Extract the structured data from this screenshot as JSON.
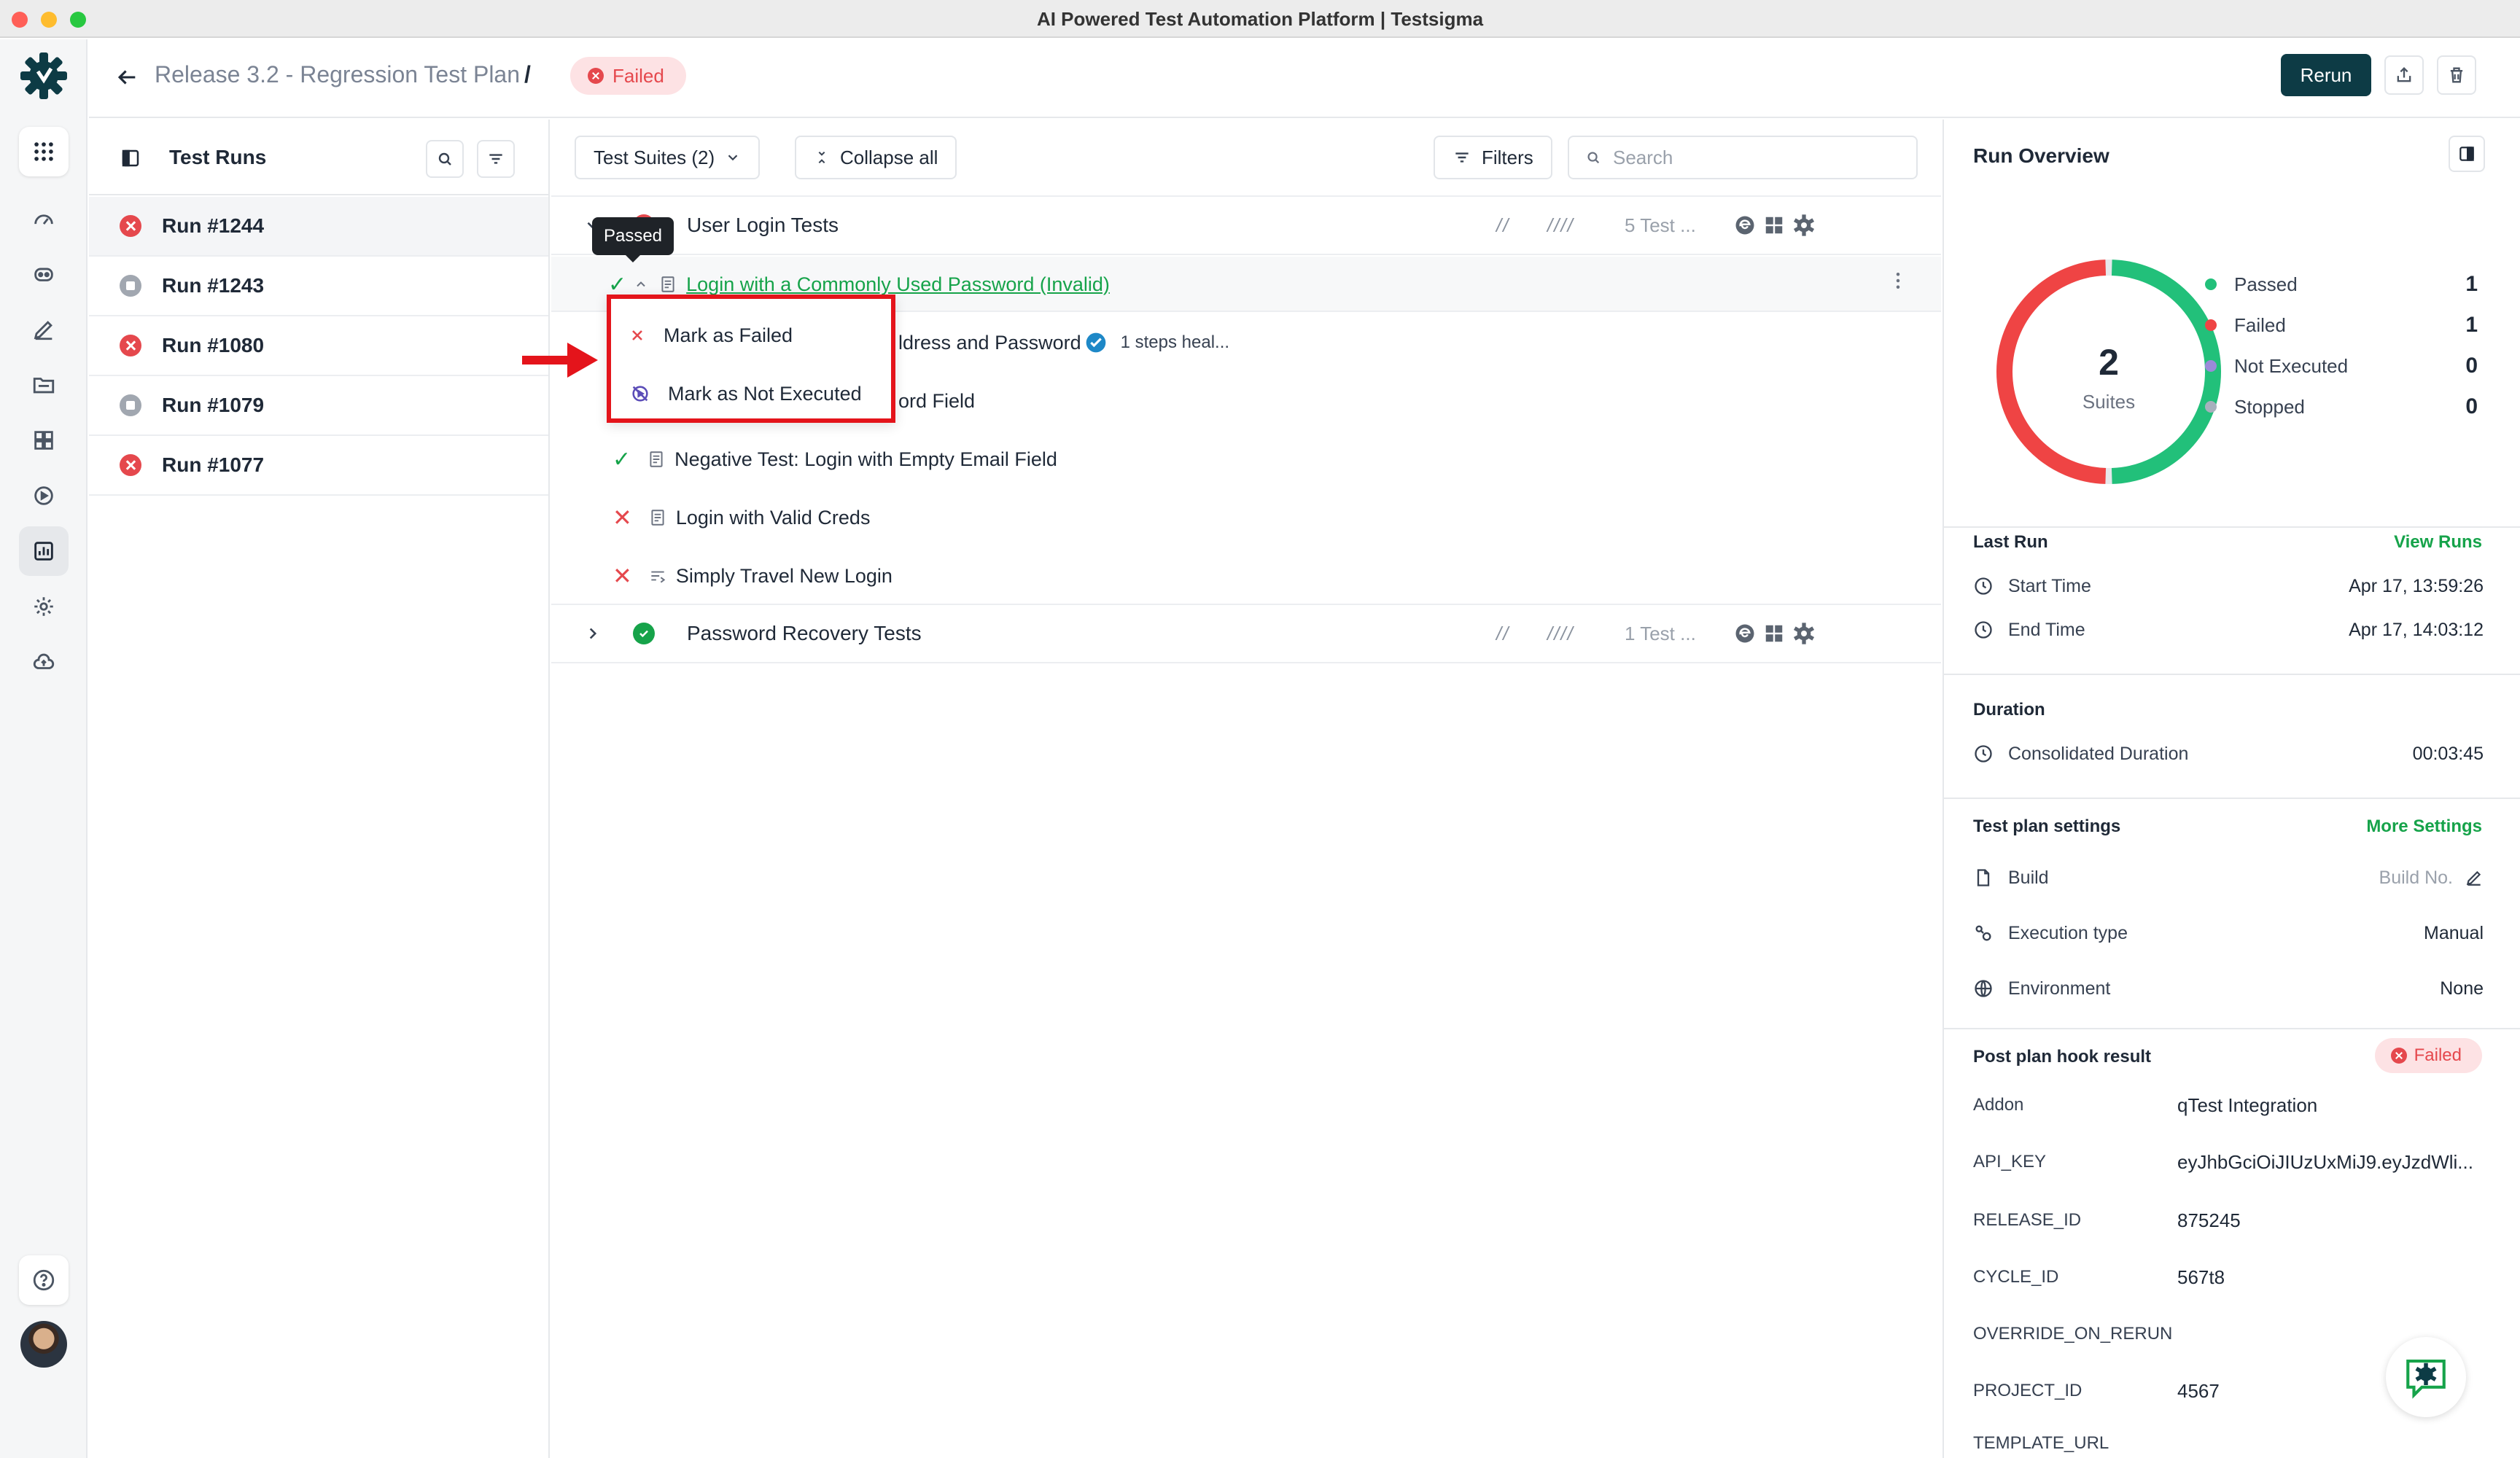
{
  "window": {
    "title": "AI Powered Test Automation Platform | Testsigma"
  },
  "header": {
    "breadcrumb": "Release 3.2 - Regression Test Plan",
    "separator": "/",
    "status": "Failed",
    "rerun_label": "Rerun"
  },
  "runs_panel": {
    "title": "Test Runs",
    "runs": [
      {
        "label": "Run #1244",
        "status": "failed"
      },
      {
        "label": "Run #1243",
        "status": "stopped"
      },
      {
        "label": "Run #1080",
        "status": "failed"
      },
      {
        "label": "Run #1079",
        "status": "stopped"
      },
      {
        "label": "Run #1077",
        "status": "failed"
      }
    ]
  },
  "toolbar": {
    "suites_label": "Test Suites (2)",
    "collapse_label": "Collapse all",
    "filters_label": "Filters",
    "search_placeholder": "Search"
  },
  "suites": [
    {
      "name": "User Login Tests",
      "slash1": "//",
      "slash2": "////",
      "count": "5 Test ...",
      "status": "failed"
    },
    {
      "name": "Password Recovery Tests",
      "slash1": "//",
      "slash2": "////",
      "count": "1 Test ...",
      "status": "passed"
    }
  ],
  "cases": [
    {
      "name": "Login with a Commonly Used Password (Invalid)",
      "status": "passed"
    },
    {
      "name": "ldress and Password",
      "heal": "1 steps heal...",
      "status": "hidden"
    },
    {
      "name": "ord Field",
      "status": "hidden"
    },
    {
      "name": "Negative Test: Login with Empty Email Field",
      "status": "passed"
    },
    {
      "name": "Login with Valid Creds",
      "status": "failed"
    },
    {
      "name": "Simply Travel New Login",
      "status": "failed"
    }
  ],
  "tooltip": "Passed",
  "menu": {
    "mark_failed": "Mark as Failed",
    "mark_not_executed": "Mark as Not Executed"
  },
  "overview": {
    "title": "Run Overview",
    "donut_total": "2",
    "donut_label": "Suites",
    "chart_values": {
      "passed": 1,
      "failed": 1
    },
    "legend": [
      {
        "label": "Passed",
        "value": "1",
        "color": "#22c07a"
      },
      {
        "label": "Failed",
        "value": "1",
        "color": "#ef4444"
      },
      {
        "label": "Not Executed",
        "value": "0",
        "color": "#9b8ad9"
      },
      {
        "label": "Stopped",
        "value": "0",
        "color": "#a8b0bd"
      }
    ],
    "last_run": {
      "title": "Last Run",
      "link": "View Runs",
      "start_label": "Start Time",
      "start_value": "Apr 17, 13:59:26",
      "end_label": "End Time",
      "end_value": "Apr 17, 14:03:12"
    },
    "duration": {
      "title": "Duration",
      "label": "Consolidated Duration",
      "value": "00:03:45"
    },
    "settings": {
      "title": "Test plan settings",
      "link": "More Settings",
      "build_label": "Build",
      "build_placeholder": "Build No.",
      "exec_label": "Execution type",
      "exec_value": "Manual",
      "env_label": "Environment",
      "env_value": "None"
    },
    "hook": {
      "title": "Post plan hook result",
      "status": "Failed",
      "rows": [
        {
          "key": "Addon",
          "value": "qTest Integration"
        },
        {
          "key": "API_KEY",
          "value": "eyJhbGciOiJIUzUxMiJ9.eyJzdWli..."
        },
        {
          "key": "RELEASE_ID",
          "value": "875245"
        },
        {
          "key": "CYCLE_ID",
          "value": "567t8"
        },
        {
          "key": "OVERRIDE_ON_RERUN",
          "value": ""
        },
        {
          "key": "PROJECT_ID",
          "value": "4567"
        },
        {
          "key": "TEMPLATE_URL",
          "value": ""
        }
      ]
    }
  },
  "colors": {
    "brand": "#0d3b45",
    "failed": "#e5484d",
    "passed": "#16a34a",
    "highlight": "#e4141b"
  }
}
